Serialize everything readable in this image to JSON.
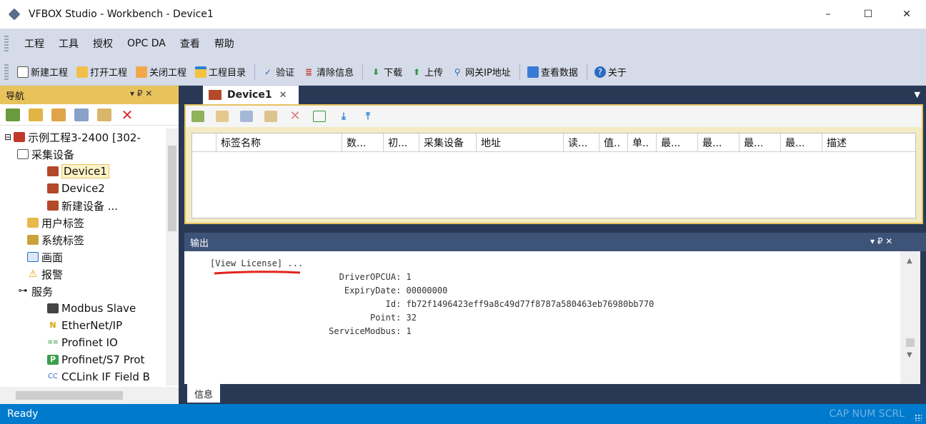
{
  "window": {
    "title": "VFBOX Studio - Workbench - Device1",
    "minimize": "–",
    "maximize": "☐",
    "close": "✕"
  },
  "menu": {
    "items": [
      "工程",
      "工具",
      "授权",
      "OPC DA",
      "查看",
      "帮助"
    ]
  },
  "toolbar": {
    "new_project": "新建工程",
    "open_project": "打开工程",
    "close_project": "关闭工程",
    "project_dir": "工程目录",
    "verify": "验证",
    "clear_info": "清除信息",
    "download": "下载",
    "upload": "上传",
    "gateway_ip": "网关IP地址",
    "view_data": "查看数据",
    "about": "关于"
  },
  "nav": {
    "title": "导航",
    "pin": "▾ ₽ ✕",
    "tree": {
      "project": "示例工程3-2400 [302-",
      "collect_devices": "采集设备",
      "device1": "Device1",
      "device2": "Device2",
      "new_device": "新建设备 ...",
      "user_tags": "用户标签",
      "system_tags": "系统标签",
      "screen": "画面",
      "alarm": "报警",
      "services": "服务",
      "modbus_slave": "Modbus Slave",
      "ethernet_ip": "EtherNet/IP",
      "profinet_io": "Profinet IO",
      "profinet_s7": "Profinet/S7 Prot",
      "cclink": "CCLink IF Field B"
    }
  },
  "document": {
    "tab_label": "Device1",
    "tab_close": "✕",
    "columns": [
      "标签名称",
      "数...",
      "初...",
      "采集设备",
      "地址",
      "读...",
      "值..",
      "单..",
      "最...",
      "最...",
      "最...",
      "最...",
      "描述"
    ]
  },
  "output": {
    "title": "输出",
    "controls": "▾ ₽ ✕",
    "lines": [
      "[View License] ...",
      "                         DriverOPCUA: 1",
      "                          ExpiryDate: 00000000",
      "                                  Id: fb72f1496423eff9a8c49d77f8787a580463eb76980bb770",
      "                               Point: 32",
      "                       ServiceModbus: 1"
    ],
    "tab_info": "信息"
  },
  "status": {
    "text": "Ready",
    "indicators": "CAP  NUM  SCRL"
  },
  "colors": {
    "chrome": "#d6dbe9",
    "dark_frame": "#293955",
    "accent_yellow": "#e8c35c",
    "statusbar": "#007acc",
    "underline": "#e0241b"
  }
}
